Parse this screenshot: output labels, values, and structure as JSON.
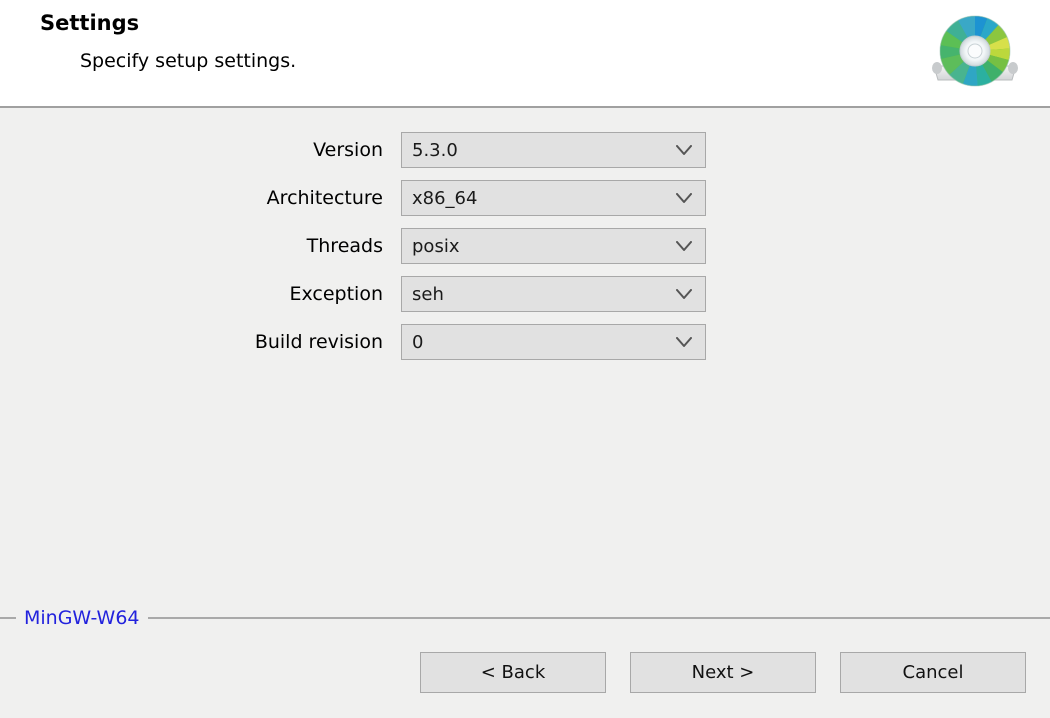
{
  "header": {
    "title": "Settings",
    "subtitle": "Specify setup settings.",
    "logo_icon": "optical-disc-icon"
  },
  "form": {
    "rows": [
      {
        "label": "Version",
        "value": "5.3.0",
        "icon": "chevron-down-icon"
      },
      {
        "label": "Architecture",
        "value": "x86_64",
        "icon": "chevron-down-icon"
      },
      {
        "label": "Threads",
        "value": "posix",
        "icon": "chevron-down-icon"
      },
      {
        "label": "Exception",
        "value": "seh",
        "icon": "chevron-down-icon"
      },
      {
        "label": "Build revision",
        "value": "0",
        "icon": "chevron-down-icon"
      }
    ]
  },
  "groupbox": {
    "legend": "MinGW-W64"
  },
  "buttons": {
    "back": "< Back",
    "next": "Next >",
    "cancel": "Cancel"
  },
  "colors": {
    "legend_blue": "#2222dd",
    "body_background": "#f0f0ef",
    "header_background": "#ffffff",
    "control_face": "#e1e1e1",
    "control_border": "#a8a8a8",
    "separator": "#a9a9a9"
  }
}
